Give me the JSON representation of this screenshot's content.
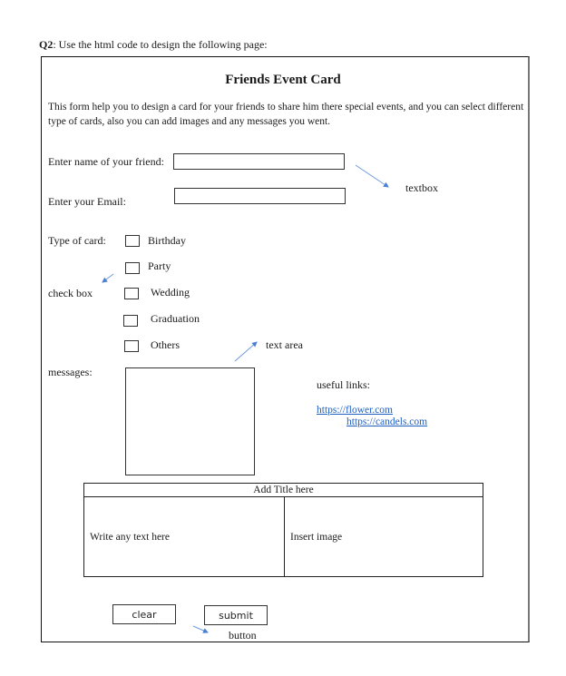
{
  "question": {
    "label": "Q2",
    "text": ": Use the html code to design the following page:"
  },
  "card": {
    "title": "Friends Event Card",
    "description": "This form help you to design a card for your friends to share him there special events, and you can select different type of cards, also you can add images and any messages you went."
  },
  "form": {
    "friend_name_label": "Enter name of your friend:",
    "friend_name_value": "",
    "email_label": "Enter your Email:",
    "email_value": "",
    "card_type_label": "Type of card:",
    "card_types": [
      {
        "label": "Birthday",
        "checked": false
      },
      {
        "label": "Party",
        "checked": false
      },
      {
        "label": "Wedding",
        "checked": false
      },
      {
        "label": "Graduation",
        "checked": false
      },
      {
        "label": "Others",
        "checked": false
      }
    ],
    "messages_label": "messages:",
    "messages_value": ""
  },
  "links": {
    "heading": "useful links:",
    "items": [
      {
        "text": "https://flower.com"
      },
      {
        "text": "https://candels.com"
      }
    ],
    "color": "#1f5fbf"
  },
  "table": {
    "header": "Add Title here",
    "left_cell": "Write any text here",
    "right_cell": "Insert image"
  },
  "buttons": {
    "clear_label": "clear",
    "submit_label": "submit"
  },
  "annotations": {
    "textbox": "textbox",
    "check_box": "check box",
    "text_area": "text area",
    "button": "button",
    "arrow_color": "#4a7fd4"
  }
}
